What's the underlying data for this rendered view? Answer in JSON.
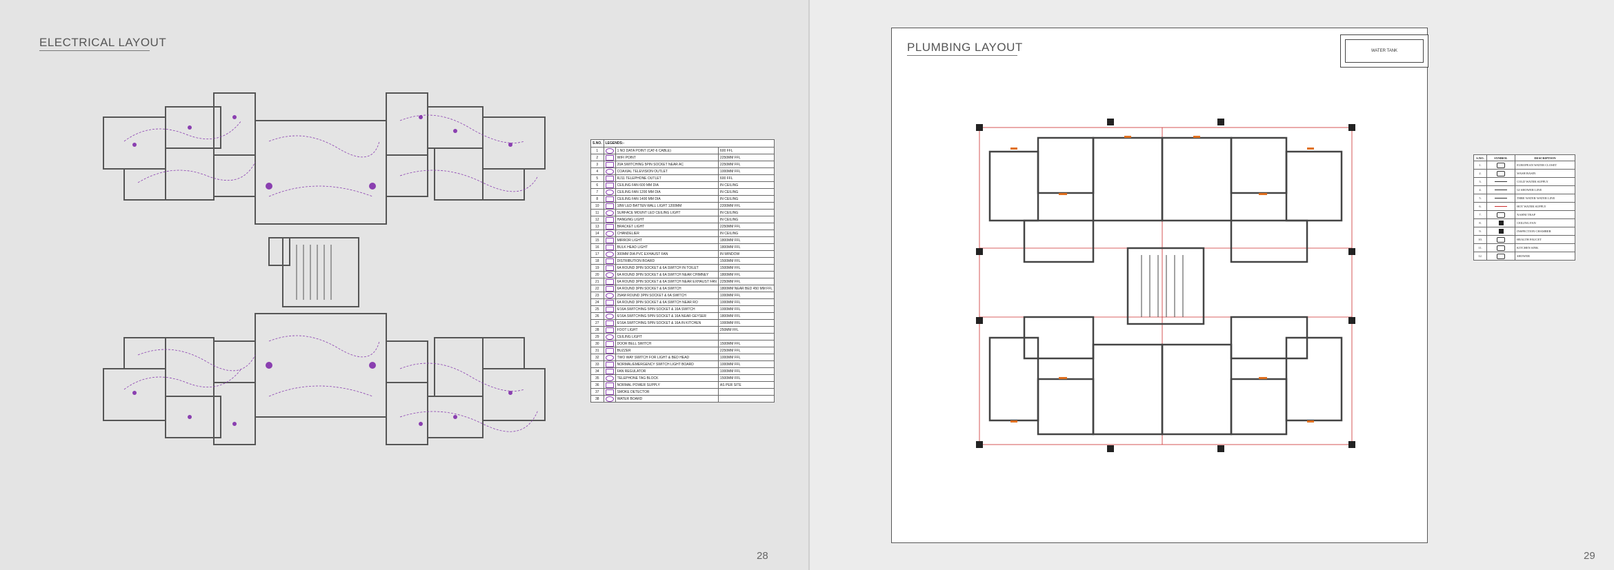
{
  "left_page": {
    "title": "ELECTRICAL LAYOUT",
    "page_number": "28",
    "legend": {
      "header_sno": "S.NO.",
      "header_title": "LEGENDS:-",
      "rows": [
        {
          "no": "1",
          "desc": "1 NO DATA POINT (CAT-6 CABLE)",
          "height": "600 FFL"
        },
        {
          "no": "2",
          "desc": "WIFI POINT",
          "height": "2250MM FFL"
        },
        {
          "no": "3",
          "desc": "20A SWITCHING 5PIN SOCKET NEAR AC",
          "height": "2250MM FFL"
        },
        {
          "no": "4",
          "desc": "COAXIAL TELEVISION OUTLET",
          "height": "1000MM FFL"
        },
        {
          "no": "5",
          "desc": "RJ11 TELEPHONE OUTLET",
          "height": "600 FFL"
        },
        {
          "no": "6",
          "desc": "CEILING FAN 600 MM DIA",
          "height": "IN CEILING"
        },
        {
          "no": "7",
          "desc": "CEILING FAN 1200 MM DIA",
          "height": "IN CEILING"
        },
        {
          "no": "8",
          "desc": "CEILING FAN 1400 MM DIA",
          "height": "IN CEILING"
        },
        {
          "no": "10",
          "desc": "18W LED BATTEN WALL LIGHT 1200MM",
          "height": "2200MM FFL"
        },
        {
          "no": "11",
          "desc": "SURFACE MOUNT LED CEILING LIGHT",
          "height": "IN CEILING"
        },
        {
          "no": "12",
          "desc": "HANGING LIGHT",
          "height": "IN CEILING"
        },
        {
          "no": "13",
          "desc": "BRACKET LIGHT",
          "height": "2250MM FFL"
        },
        {
          "no": "14",
          "desc": "CHANDELIER",
          "height": "IN CEILING"
        },
        {
          "no": "15",
          "desc": "MIRROR LIGHT",
          "height": "1800MM FFL"
        },
        {
          "no": "16",
          "desc": "BULK HEAD LIGHT",
          "height": "1800MM FFL"
        },
        {
          "no": "17",
          "desc": "300MM DIA PVC EXHAUST FAN",
          "height": "IN WINDOW"
        },
        {
          "no": "18",
          "desc": "DISTRIBUTION BOARD",
          "height": "1500MM FFL"
        },
        {
          "no": "19",
          "desc": "6A ROUND 3PIN SOCKET & 6A SWITCH IN TOILET",
          "height": "1500MM FFL"
        },
        {
          "no": "20",
          "desc": "6A ROUND 3PIN SOCKET & 6A SWITCH NEAR CHIMNEY",
          "height": "1800MM FFL"
        },
        {
          "no": "21",
          "desc": "6A ROUND 3PIN SOCKET & 6A SWITCH NEAR EXHAUST FAN",
          "height": "2250MM FFL"
        },
        {
          "no": "22",
          "desc": "6A ROUND 3PIN SOCKET & 6A SWITCH",
          "height": "1800MM NEAR BED 450 MM FFL"
        },
        {
          "no": "23",
          "desc": "25AM ROUND 3PIN SOCKET & 6A SWITCH",
          "height": "1000MM FFL"
        },
        {
          "no": "24",
          "desc": "6A ROUND 3PIN SOCKET & 6A SWITCH NEAR RO",
          "height": "1000MM FFL"
        },
        {
          "no": "25",
          "desc": "6/16A SWITCHING 5PIN SOCKET & 16A SWITCH",
          "height": "1000MM FFL"
        },
        {
          "no": "26",
          "desc": "6/16A SWITCHING 5PIN SOCKET & 16A NEAR GEYSER",
          "height": "1800MM FFL"
        },
        {
          "no": "27",
          "desc": "6/16A SWITCHING 5PIN SOCKET & 16A IN KITCHEN",
          "height": "1000MM FFL"
        },
        {
          "no": "28",
          "desc": "FOOT LIGHT",
          "height": "250MM FFL"
        },
        {
          "no": "29",
          "desc": "CEILING LIGHT",
          "height": ""
        },
        {
          "no": "30",
          "desc": "DOOR BELL SWITCH",
          "height": "1500MM FFL"
        },
        {
          "no": "31",
          "desc": "BUZZER",
          "height": "2250MM FFL"
        },
        {
          "no": "32",
          "desc": "TWO WAY SWITCH FOR LIGHT & BED HEAD",
          "height": "1000MM FFL"
        },
        {
          "no": "33",
          "desc": "NORMAL/EMERGENCY SWITCH LIGHT BOARD",
          "height": "1000MM FFL"
        },
        {
          "no": "34",
          "desc": "FAN REGULATOR",
          "height": "1000MM FFL"
        },
        {
          "no": "35",
          "desc": "TELEPHONE TAG BLOCK",
          "height": "1500MM FFL"
        },
        {
          "no": "36",
          "desc": "NORMAL POWER SUPPLY",
          "height": "AS PER SITE"
        },
        {
          "no": "37",
          "desc": "SMOKE DETECTOR",
          "height": ""
        },
        {
          "no": "38",
          "desc": "WATER BOARD",
          "height": ""
        }
      ]
    }
  },
  "right_page": {
    "title": "PLUMBING LAYOUT",
    "page_number": "29",
    "tank_label": "WATER TANK",
    "legend": {
      "header_sno": "S.NO.",
      "header_symbol": "SYMBOL",
      "header_desc": "DESCRIPTION",
      "rows": [
        {
          "no": "1.",
          "desc": "EUROPEAN WATER CLOSET"
        },
        {
          "no": "2.",
          "desc": "WASH BASIN"
        },
        {
          "no": "3.",
          "desc": "COLD WATER SUPPLY"
        },
        {
          "no": "4.",
          "desc": "GI SHOWER LINE"
        },
        {
          "no": "5.",
          "desc": "THRE WATER WATER LINE"
        },
        {
          "no": "6.",
          "desc": "HOT WATER SUPPLY"
        },
        {
          "no": "7.",
          "desc": "NAHNI TRAP"
        },
        {
          "no": "8.",
          "desc": "CEILING FAN"
        },
        {
          "no": "9.",
          "desc": "INSPECTION CHAMBER"
        },
        {
          "no": "10.",
          "desc": "HEALTH FAUCET"
        },
        {
          "no": "11.",
          "desc": "KITCHEN SINK"
        },
        {
          "no": "12.",
          "desc": "SHOWER"
        }
      ]
    }
  },
  "colors": {
    "left_bg": "#e4e4e4",
    "right_bg": "#ececec",
    "wall": "#555555",
    "electrical_purple": "#8a3fb0",
    "room_text_blue": "#2b3fa0",
    "plumbing_red": "#cc2b2b",
    "plumbing_orange": "#e07020"
  }
}
